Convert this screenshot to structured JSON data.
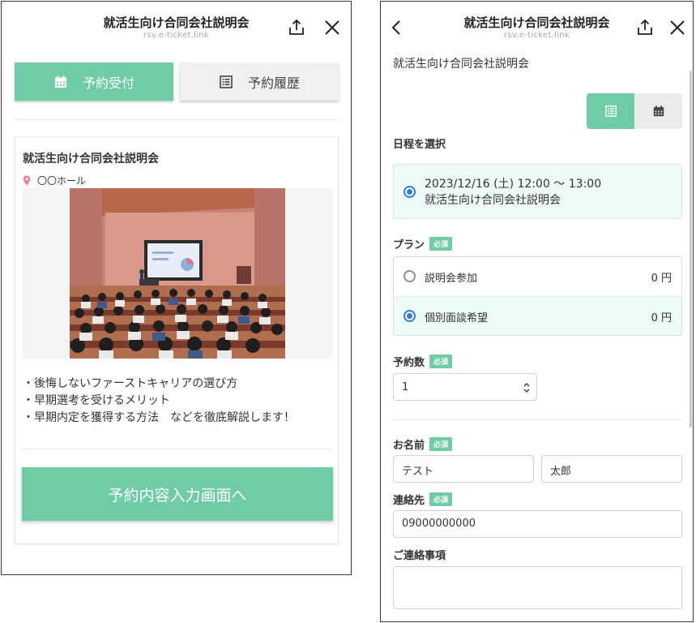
{
  "left": {
    "header": {
      "title": "就活生向け合同会社説明会",
      "url": "rsv.e-ticket.link"
    },
    "tabs": {
      "reserve": "予約受付",
      "history": "予約履歴"
    },
    "event": {
      "title": "就活生向け合同会社説明会",
      "venue": "〇〇ホール",
      "bullets": [
        "・後悔しないファーストキャリアの選び方",
        "・早期選考を受けるメリット",
        "・早期内定を獲得する方法　などを徹底解説します！"
      ]
    },
    "cta": "予約内容入力画面へ"
  },
  "right": {
    "header": {
      "title": "就活生向け合同会社説明会",
      "url": "rsv.e-ticket.link"
    },
    "page_title": "就活生向け合同会社説明会",
    "schedule": {
      "label": "日程を選択",
      "datetime": "2023/12/16 (土) 12:00 〜 13:00",
      "event_name": "就活生向け合同会社説明会"
    },
    "plan": {
      "label": "プラン",
      "required": "必須",
      "options": [
        {
          "name": "説明会参加",
          "price": "0 円"
        },
        {
          "name": "個別面談希望",
          "price": "0 円"
        }
      ]
    },
    "quantity": {
      "label": "予約数",
      "required": "必須",
      "value": "1"
    },
    "name": {
      "label": "お名前",
      "required": "必須",
      "last": "テスト",
      "first": "太郎"
    },
    "contact": {
      "label": "連絡先",
      "required": "必須",
      "value": "09000000000"
    },
    "notes": {
      "label": "ご連絡事項",
      "value": ""
    }
  },
  "colors": {
    "accent": "#6fcca5",
    "radio_selected": "#2f7de1",
    "selected_row_bg": "#eefaf6"
  }
}
